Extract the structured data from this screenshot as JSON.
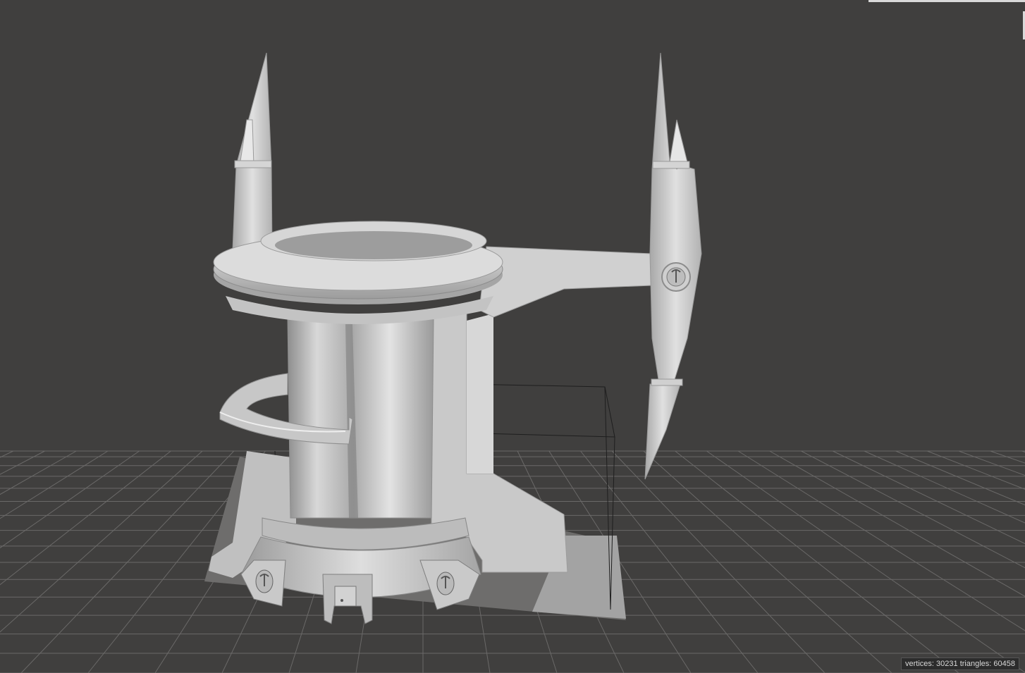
{
  "viewport": {
    "background_color": "#403f3e",
    "grid_color": "#6a6968",
    "model_color": "#cfcfcf",
    "stats": {
      "vertices_label": "vertices:",
      "vertices_value": "30231",
      "triangles_label": "triangles:",
      "triangles_value": "60458"
    }
  }
}
